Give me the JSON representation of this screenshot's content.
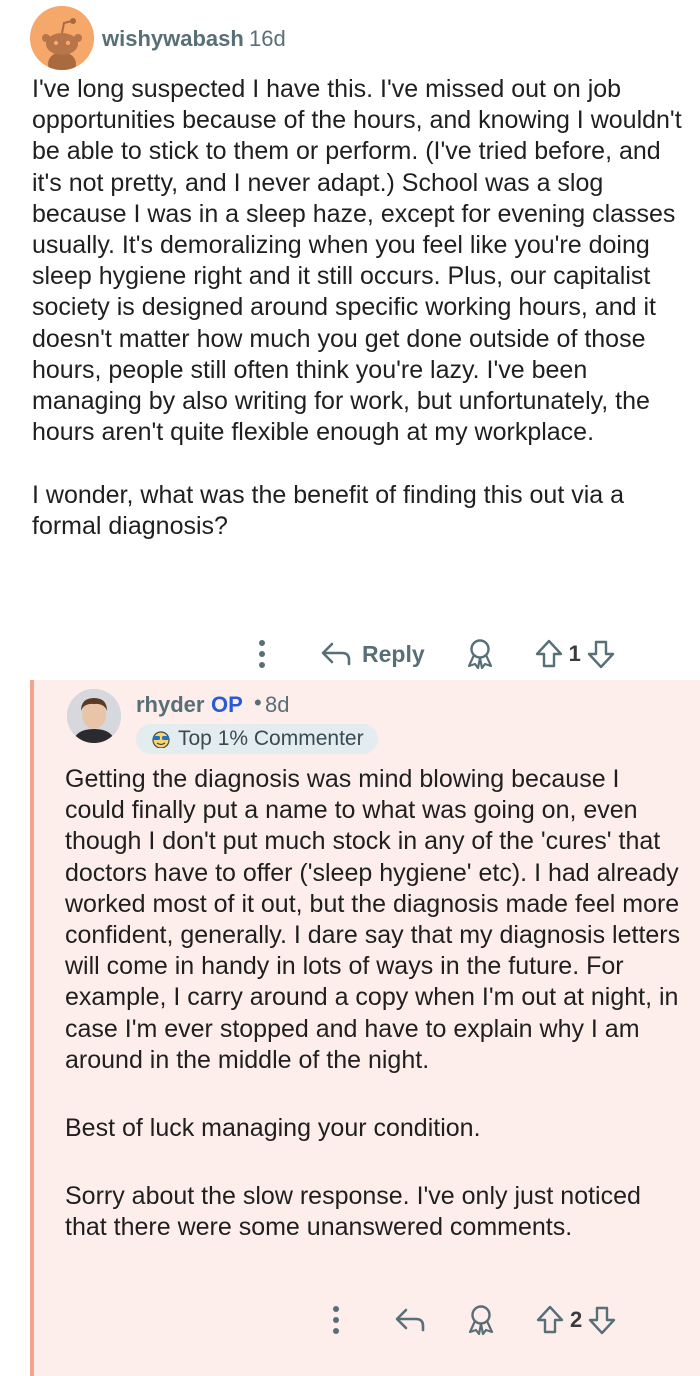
{
  "parent": {
    "author": "wishywabash",
    "age": "16d",
    "paragraphs": [
      "I've long suspected I have this. I've missed out on job opportunities because of the hours, and knowing I wouldn't be able to stick to them or perform. (I've tried before, and it's not pretty, and I never adapt.) School was a slog because I was in a sleep haze, except for evening classes usually. It's demoralizing when you feel like you're doing sleep hygiene right and it still occurs. Plus, our capitalist society is designed around specific working hours, and it doesn't matter how much you get done outside of those hours, people still often think you're lazy. I've been managing by also writing for work, but unfortunately, the hours aren't quite flexible enough at my workplace.",
      "I wonder, what was the benefit of finding this out via a formal diagnosis?"
    ],
    "reply_label": "Reply",
    "score": "1"
  },
  "reply": {
    "author": "rhyder",
    "op_label": "OP",
    "separator": "•",
    "age": "8d",
    "flair": "Top 1% Commenter",
    "paragraphs": [
      "Getting the diagnosis was mind blowing because I could finally put a name to what was going on, even though I don't put much stock in any of the 'cures' that doctors have to offer ('sleep hygiene' etc). I had already worked most of it out, but the diagnosis made feel more confident, generally. I dare say that my diagnosis letters will come in handy in lots of ways in the future. For example, I carry around a copy when I'm out at night, in case I'm ever stopped and have to explain why I am around in the middle of the night.",
      "Best of luck managing your condition.",
      "Sorry about the slow response. I've only just noticed that there were some unanswered comments."
    ],
    "score": "2"
  },
  "colors": {
    "meta_text": "#576f76",
    "op_blue": "#2a5bd7",
    "reply_background": "#fdeeeb",
    "reply_thread_line": "#f2a58d",
    "avatar_orange": "#f6a76a"
  },
  "icons": {
    "more": "more-vertical-icon",
    "reply": "reply-arrow-icon",
    "award": "award-icon",
    "upvote": "upvote-arrow-icon",
    "downvote": "downvote-arrow-icon",
    "flair": "sunglasses-icon"
  }
}
